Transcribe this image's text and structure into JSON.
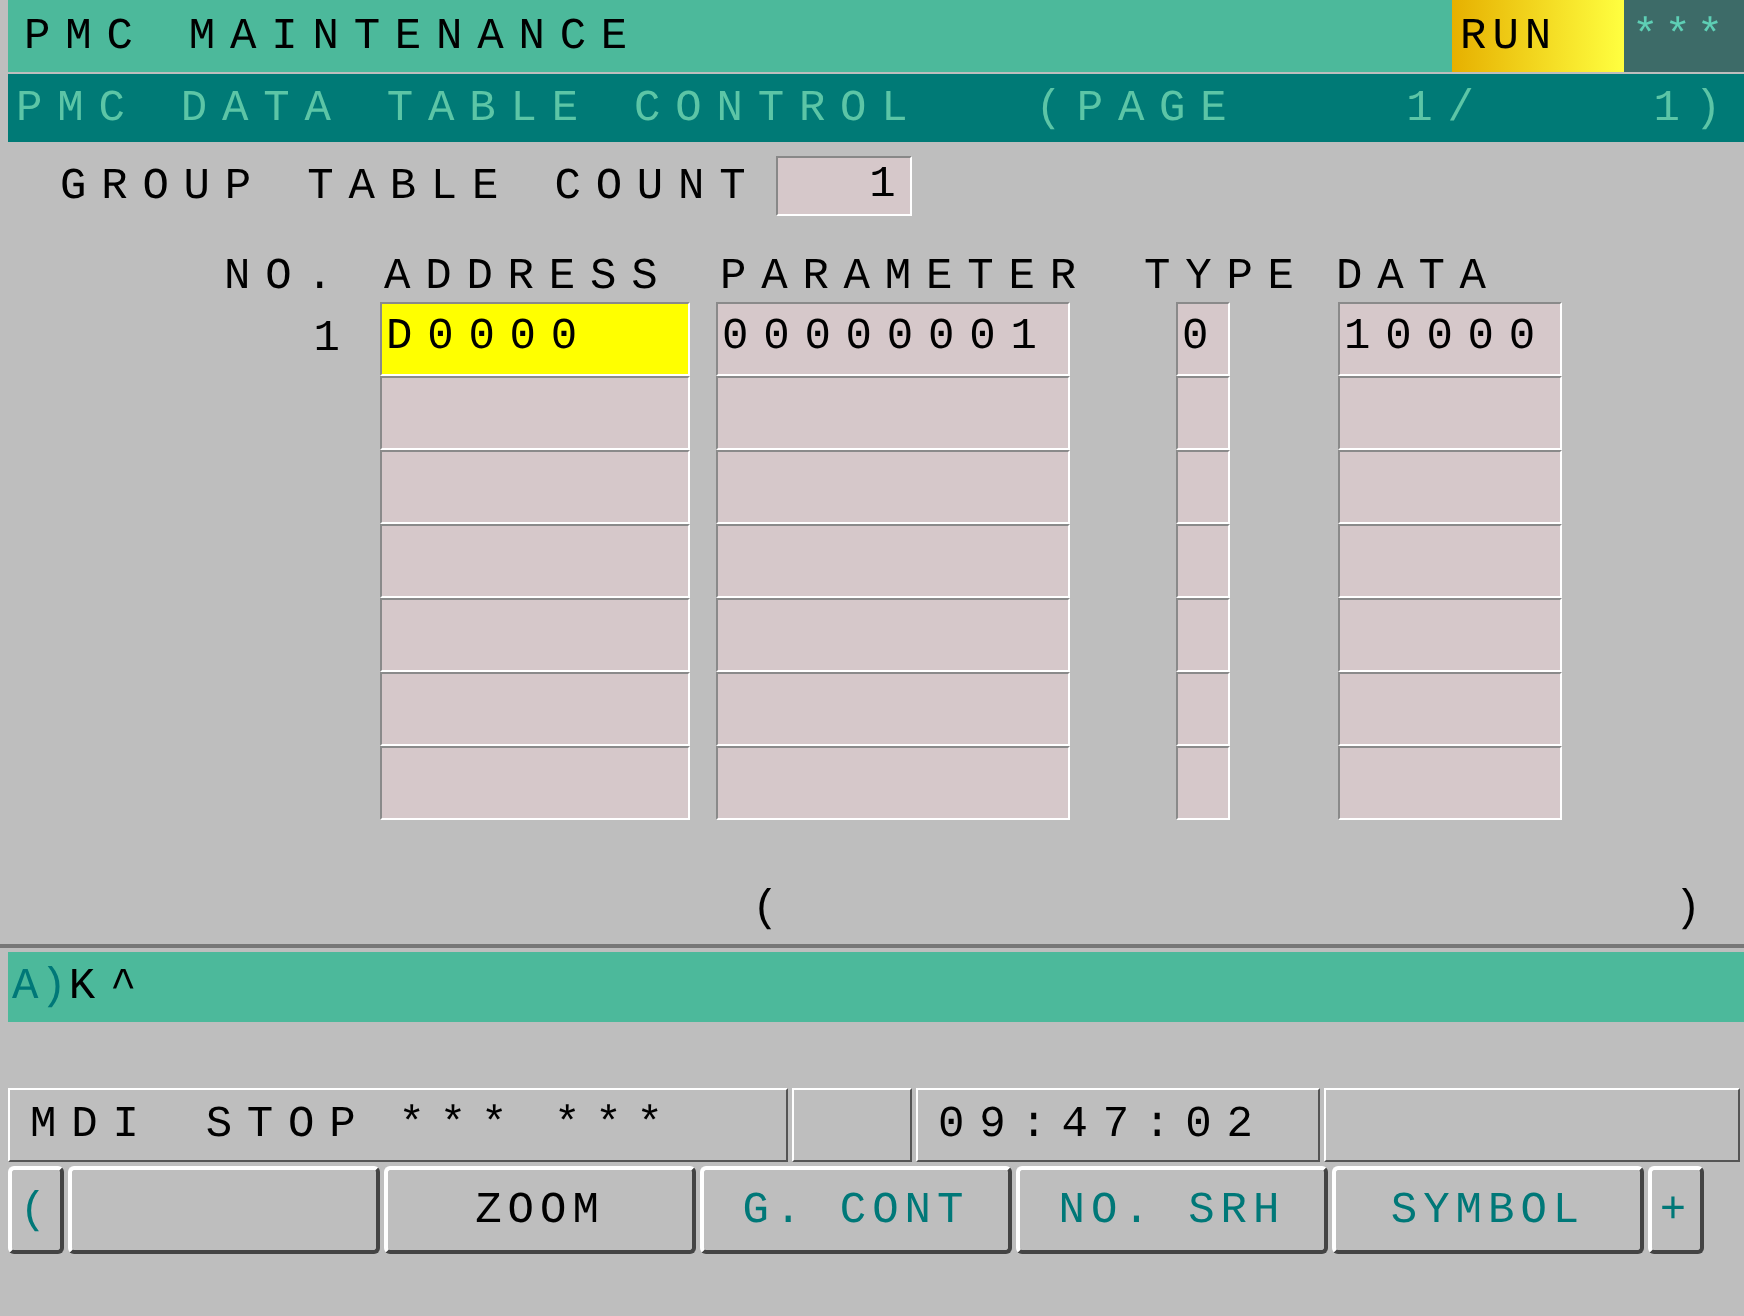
{
  "title_bar": {
    "title": "PMC MAINTENANCE",
    "run_state": "RUN",
    "alarm": "***"
  },
  "sub_bar": {
    "title": "PMC DATA TABLE CONTROL",
    "page": "(PAGE    1/    1)"
  },
  "group_table_count": {
    "label": "GROUP TABLE COUNT",
    "value": "1"
  },
  "table": {
    "columns": [
      "NO.",
      "ADDRESS",
      "PARAMETER",
      "TYPE",
      "DATA"
    ],
    "rows": [
      {
        "no": "1",
        "address": "D0000",
        "parameter": "00000001",
        "type": "0",
        "data": "10000",
        "selected": true
      },
      {
        "selected": false
      },
      {
        "selected": false
      },
      {
        "selected": false
      },
      {
        "selected": false
      },
      {
        "selected": false
      },
      {
        "selected": false
      }
    ]
  },
  "comment_brackets": {
    "open": "(",
    "close": ")"
  },
  "input_line": {
    "prompt": "A)",
    "value": "K^"
  },
  "status_bar": {
    "mode": "MDI",
    "state": "STOP",
    "field_1": "***",
    "field_2": "***",
    "time": "09:47:02"
  },
  "softkeys": [
    {
      "label": "(",
      "kind": "arrow",
      "color": "#007878"
    },
    {
      "kind": "key"
    },
    {
      "label": "ZOOM",
      "kind": "key",
      "color": "#000000"
    },
    {
      "label": "G. CONT",
      "kind": "key",
      "color": "#007878"
    },
    {
      "label": "NO. SRH",
      "kind": "key",
      "color": "#007878"
    },
    {
      "label": "SYMBOL",
      "kind": "key",
      "color": "#007878"
    },
    {
      "label": "+",
      "kind": "arrow",
      "color": "#007878"
    }
  ]
}
